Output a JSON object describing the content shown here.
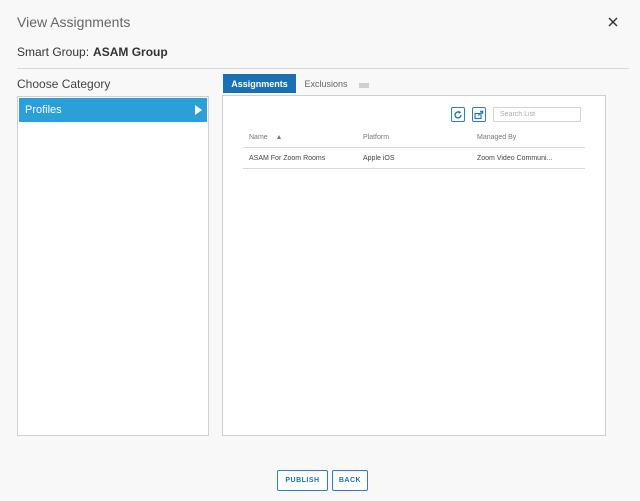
{
  "dialog": {
    "title": "View Assignments",
    "close_icon": "close-icon"
  },
  "smart_group": {
    "label": "Smart Group:",
    "name": "ASAM Group"
  },
  "category": {
    "heading": "Choose Category",
    "items": [
      {
        "label": "Profiles",
        "selected": true
      }
    ]
  },
  "tabs": [
    {
      "label": "Assignments",
      "active": true
    },
    {
      "label": "Exclusions",
      "active": false
    }
  ],
  "toolbar": {
    "refresh_icon": "refresh-icon",
    "export_icon": "export-icon",
    "search_placeholder": "Search List"
  },
  "grid": {
    "columns": [
      "Name",
      "Platform",
      "Managed By"
    ],
    "sort_column": "Name",
    "rows": [
      {
        "name": "ASAM For Zoom Rooms",
        "platform": "Apple iOS",
        "managed_by": "Zoom Video Communi..."
      }
    ]
  },
  "footer": {
    "publish_label": "PUBLISH",
    "back_label": "BACK"
  },
  "colors": {
    "accent": "#2a9fd8",
    "tab_active": "#1b6fb5",
    "button_border": "#2a7fc8"
  }
}
